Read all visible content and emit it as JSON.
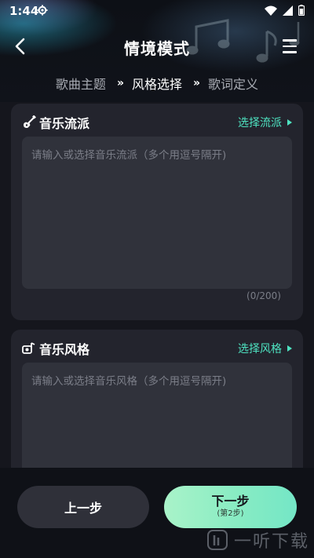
{
  "status_bar": {
    "time": "1:44"
  },
  "app_bar": {
    "title": "情境模式"
  },
  "steps": [
    {
      "label": "歌曲主题",
      "active": false
    },
    {
      "label": "风格选择",
      "active": true
    },
    {
      "label": "歌词定义",
      "active": false
    }
  ],
  "step_separator": "»",
  "genre_card": {
    "title": "音乐流派",
    "link_label": "选择流派",
    "input_value": "",
    "input_placeholder": "请输入或选择音乐流派（多个用逗号隔开)",
    "counter": "(0/200)"
  },
  "style_card": {
    "title": "音乐风格",
    "link_label": "选择风格",
    "input_value": "",
    "input_placeholder": "请输入或选择音乐风格（多个用逗号隔开)"
  },
  "footer": {
    "prev_label": "上一步",
    "next_label": "下一步",
    "next_sublabel": "(第2步)"
  },
  "watermark": {
    "text": "一听下载"
  },
  "colors": {
    "accent": "#4ee3c1",
    "next_button_gradient_start": "#a9f3c9",
    "next_button_gradient_end": "#74e6c6",
    "card_bg": "#23242d",
    "input_bg": "#30323b"
  },
  "icons": [
    "settings-gear-icon",
    "wifi-icon",
    "signal-icon",
    "battery-icon",
    "back-arrow-icon",
    "hamburger-menu-icon",
    "guitar-icon",
    "music-style-icon",
    "triangle-right-icon"
  ]
}
